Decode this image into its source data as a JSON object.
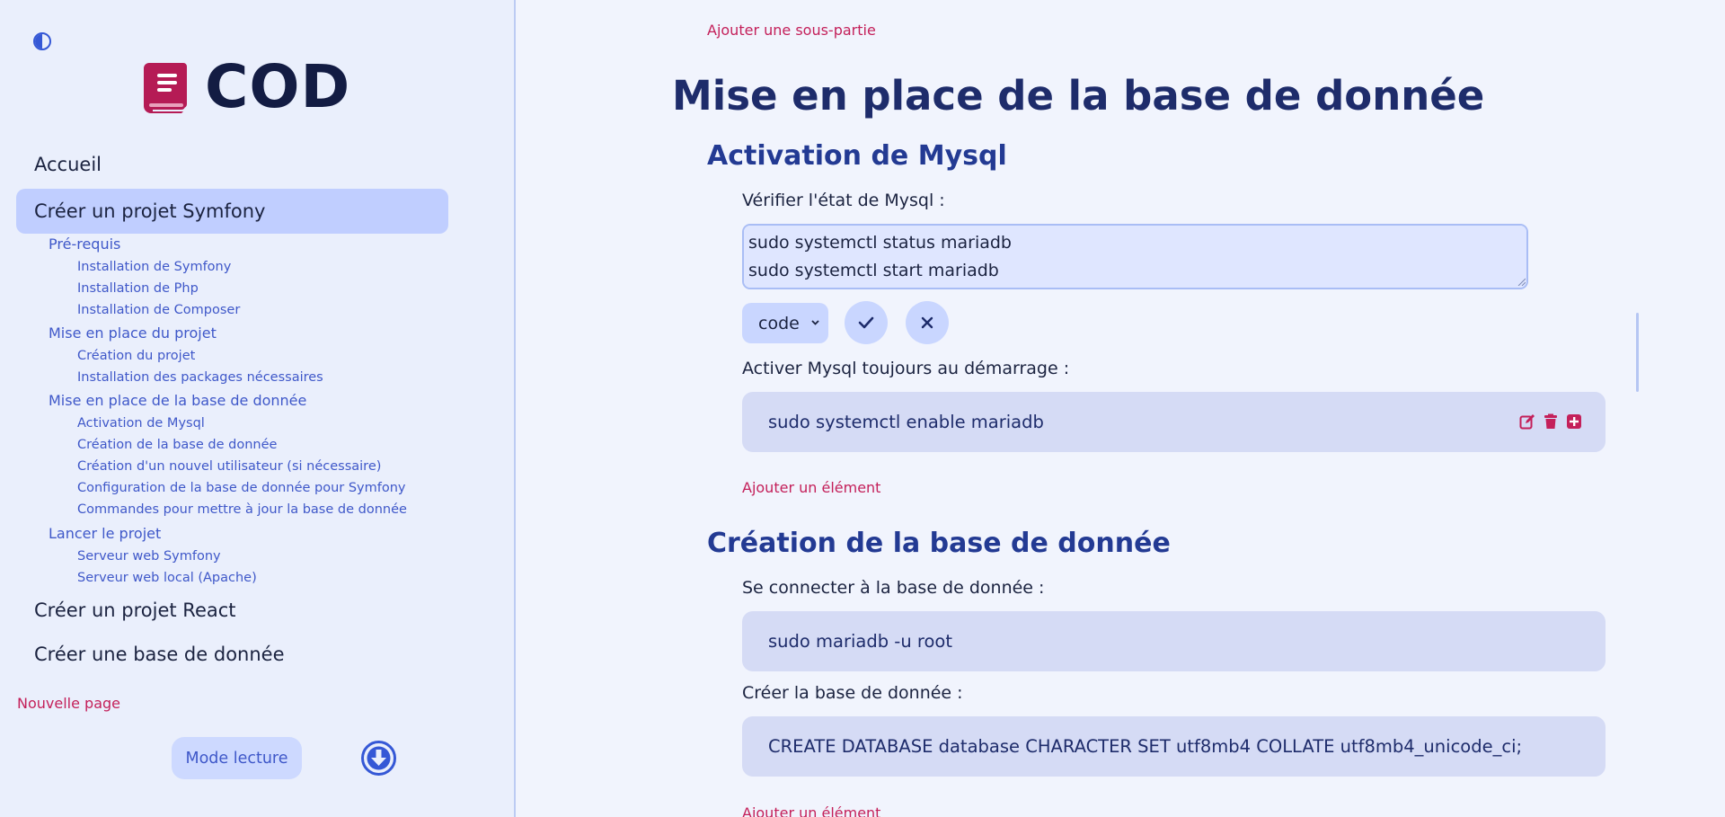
{
  "sidebar": {
    "logo_text": "COD",
    "items": [
      {
        "label": "Accueil"
      },
      {
        "label": "Créer un projet Symfony"
      },
      {
        "label": "Créer un projet React"
      },
      {
        "label": "Créer une base de donnée"
      }
    ],
    "sub": {
      "prerequis": "Pré-requis",
      "install_symfony": "Installation de Symfony",
      "install_php": "Installation de Php",
      "install_composer": "Installation de Composer",
      "mise_projet": "Mise en place du projet",
      "creation_projet": "Création du projet",
      "install_packages": "Installation des packages nécessaires",
      "mise_bdd": "Mise en place de la base de donnée",
      "activation_mysql": "Activation de Mysql",
      "creation_bdd": "Création de la base de donnée",
      "creation_user": "Création d'un nouvel utilisateur (si nécessaire)",
      "config_bdd": "Configuration de la base de donnée pour Symfony",
      "commandes_maj": "Commandes pour mettre à jour la base de donnée",
      "lancer": "Lancer le projet",
      "serveur_symfony": "Serveur web Symfony",
      "serveur_local": "Serveur web local (Apache)"
    },
    "new_page": "Nouvelle page",
    "mode_lecture": "Mode lecture"
  },
  "main": {
    "add_subpart": "Ajouter une sous-partie",
    "title": "Mise en place de la base de donnée",
    "sections": [
      {
        "heading": "Activation de Mysql",
        "label1": "Vérifier l'état de Mysql :",
        "textarea_value": "sudo systemctl status mariadb\nsudo systemctl start mariadb",
        "select_value": "code",
        "label2": "Activer Mysql toujours au démarrage :",
        "code2": "sudo systemctl enable mariadb",
        "add_element": "Ajouter un élément"
      },
      {
        "heading": "Création de la base de donnée",
        "label1": "Se connecter à la base de donnée :",
        "code1": "sudo mariadb -u root",
        "label2": "Créer la base de donnée :",
        "code2": "CREATE DATABASE database CHARACTER SET utf8mb4 COLLATE utf8mb4_unicode_ci;",
        "add_element": "Ajouter un élément"
      }
    ]
  },
  "colors": {
    "accent": "#c4205a",
    "primary": "#3f58c9",
    "active_bg": "#c0ceff"
  }
}
